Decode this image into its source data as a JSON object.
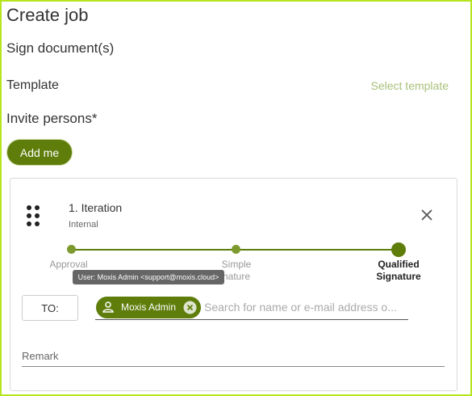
{
  "page": {
    "title": "Create job",
    "subtitle": "Sign document(s)"
  },
  "template": {
    "label": "Template",
    "select_link": "Select template"
  },
  "invite": {
    "label": "Invite persons*",
    "add_me_button": "Add me"
  },
  "iteration": {
    "title": "1. Iteration",
    "subtitle": "Internal",
    "steps": [
      {
        "line1": "Approval",
        "line2": ""
      },
      {
        "line1": "Simple",
        "line2": "nature"
      },
      {
        "line1": "Qualified",
        "line2": "Signature"
      }
    ],
    "active_step": 2,
    "tooltip": "User: Moxis Admin <support@moxis.cloud>",
    "to_button": "TO:",
    "recipient_chip": "Moxis Admin",
    "search_placeholder": "Search for name or e-mail address o...",
    "remark_label": "Remark"
  },
  "colors": {
    "accent": "#5e7d0b",
    "frame_border": "#b5e61d",
    "link": "#a9c07a"
  },
  "icons": {
    "drag": "drag-handle-icon",
    "close": "close-icon",
    "person": "person-icon",
    "remove": "remove-circle-icon"
  }
}
